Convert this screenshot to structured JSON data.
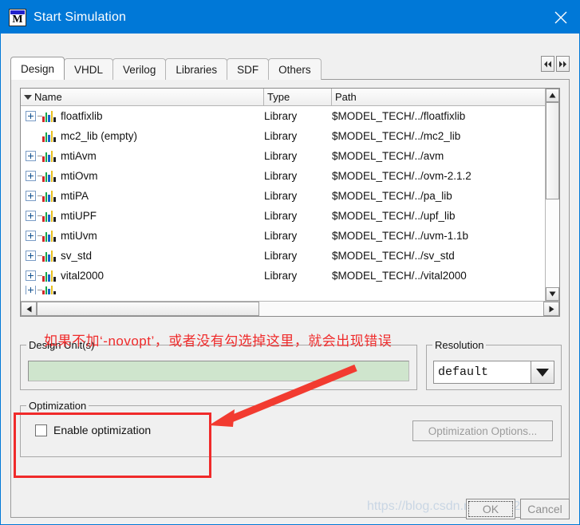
{
  "window": {
    "title": "Start Simulation",
    "app_icon": "modelsim-m-icon",
    "close_icon": "close-icon",
    "titlebar_color": "#0078d7"
  },
  "tabs": {
    "items": [
      {
        "label": "Design",
        "active": true
      },
      {
        "label": "VHDL",
        "active": false
      },
      {
        "label": "Verilog",
        "active": false
      },
      {
        "label": "Libraries",
        "active": false
      },
      {
        "label": "SDF",
        "active": false
      },
      {
        "label": "Others",
        "active": false
      }
    ],
    "scroll_left_icon": "chevron-double-left-icon",
    "scroll_right_icon": "chevron-double-right-icon"
  },
  "library_list": {
    "columns": [
      "Name",
      "Type",
      "Path"
    ],
    "sort_icon": "sort-descending-icon",
    "rows": [
      {
        "name": "floatfixlib",
        "type": "Library",
        "path": "$MODEL_TECH/../floatfixlib",
        "expandable": true
      },
      {
        "name": "mc2_lib  (empty)",
        "type": "Library",
        "path": "$MODEL_TECH/../mc2_lib",
        "expandable": false
      },
      {
        "name": "mtiAvm",
        "type": "Library",
        "path": "$MODEL_TECH/../avm",
        "expandable": true
      },
      {
        "name": "mtiOvm",
        "type": "Library",
        "path": "$MODEL_TECH/../ovm-2.1.2",
        "expandable": true
      },
      {
        "name": "mtiPA",
        "type": "Library",
        "path": "$MODEL_TECH/../pa_lib",
        "expandable": true
      },
      {
        "name": "mtiUPF",
        "type": "Library",
        "path": "$MODEL_TECH/../upf_lib",
        "expandable": true
      },
      {
        "name": "mtiUvm",
        "type": "Library",
        "path": "$MODEL_TECH/../uvm-1.1b",
        "expandable": true
      },
      {
        "name": "sv_std",
        "type": "Library",
        "path": "$MODEL_TECH/../sv_std",
        "expandable": true
      },
      {
        "name": "vital2000",
        "type": "Library",
        "path": "$MODEL_TECH/../vital2000",
        "expandable": true
      }
    ],
    "vscroll_up_icon": "scroll-up-arrow-icon",
    "vscroll_down_icon": "scroll-down-arrow-icon",
    "hscroll_left_icon": "scroll-left-arrow-icon",
    "hscroll_right_icon": "scroll-right-arrow-icon"
  },
  "design_units": {
    "legend": "Design Unit(s)",
    "value": "",
    "placeholder": "",
    "field_color": "#cfe5cd"
  },
  "resolution": {
    "legend": "Resolution",
    "selected": "default",
    "dropdown_icon": "chevron-down-icon"
  },
  "optimization": {
    "legend": "Optimization",
    "checkbox_label": "Enable optimization",
    "checked": false,
    "options_button": "Optimization Options...",
    "options_button_enabled": false
  },
  "footer": {
    "ok_label": "OK",
    "cancel_label": "Cancel"
  },
  "annotations": {
    "note_text": "如果不加‘-novopt’，或者没有勾选掉这里，就会出现错误",
    "note_color": "#ef2b2b",
    "highlight_box_color": "#f02a2a",
    "arrow_icon": "red-arrow-icon"
  },
  "watermark": {
    "text": "https://blog.csdn.net/qq_42783132"
  }
}
